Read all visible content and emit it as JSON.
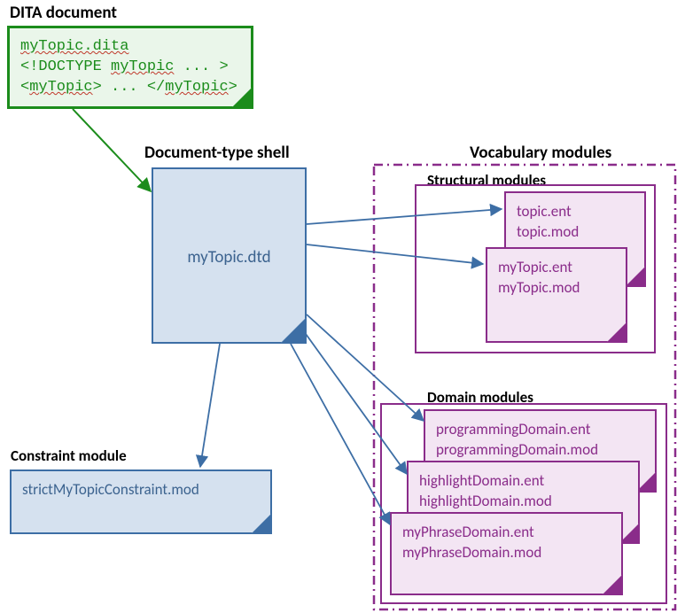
{
  "headings": {
    "dita_document": "DITA document",
    "doc_type_shell": "Document-type shell",
    "vocabulary_modules": "Vocabulary modules",
    "structural_modules": "Structural modules",
    "domain_modules": "Domain modules",
    "constraint_module": "Constraint module"
  },
  "dita_doc": {
    "file": "myTopic.dita",
    "line2_a": "<!DOCTYPE ",
    "line2_b": "myTopic",
    "line2_c": " ... >",
    "line3_a": "<",
    "line3_b": "myTopic",
    "line3_c": "> ... </",
    "line3_d": "myTopic",
    "line3_e": ">"
  },
  "shell": {
    "file": "myTopic.dtd"
  },
  "structural": {
    "box1_line1": "topic.ent",
    "box1_line2": "topic.mod",
    "box2_line1": "myTopic.ent",
    "box2_line2": "myTopic.mod"
  },
  "domain": {
    "box1_line1": "programmingDomain.ent",
    "box1_line2": "programmingDomain.mod",
    "box2_line1": "highlightDomain.ent",
    "box2_line2": "highlightDomain.mod",
    "box3_line1": "myPhraseDomain.ent",
    "box3_line2": "myPhraseDomain.mod"
  },
  "constraint": {
    "file": "strictMyTopicConstraint.mod"
  }
}
